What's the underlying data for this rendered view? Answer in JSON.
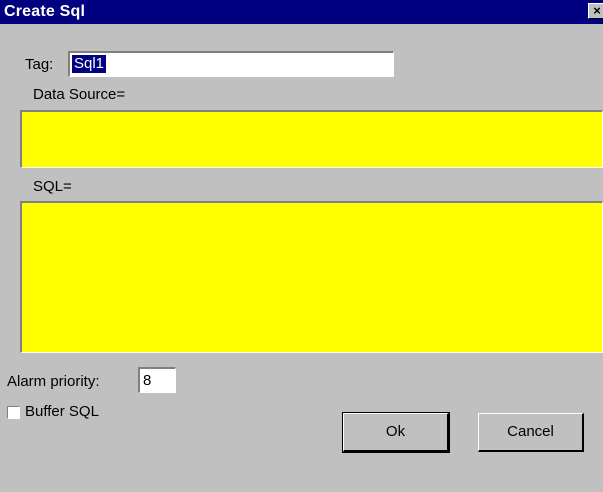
{
  "window": {
    "title": "Create Sql",
    "close_glyph": "×"
  },
  "tag": {
    "label": "Tag:",
    "value": "Sql1"
  },
  "data_source": {
    "label": "Data Source=",
    "value": ""
  },
  "sql": {
    "label": "SQL=",
    "value": ""
  },
  "alarm_priority": {
    "label": "Alarm priority:",
    "value": "8"
  },
  "buffer_sql": {
    "label": "Buffer SQL",
    "checked": false
  },
  "buttons": {
    "ok": "Ok",
    "cancel": "Cancel"
  },
  "colors": {
    "titlebar": "#000080",
    "field_highlight": "#ffff00",
    "dialog_bg": "#c0c0c0"
  }
}
